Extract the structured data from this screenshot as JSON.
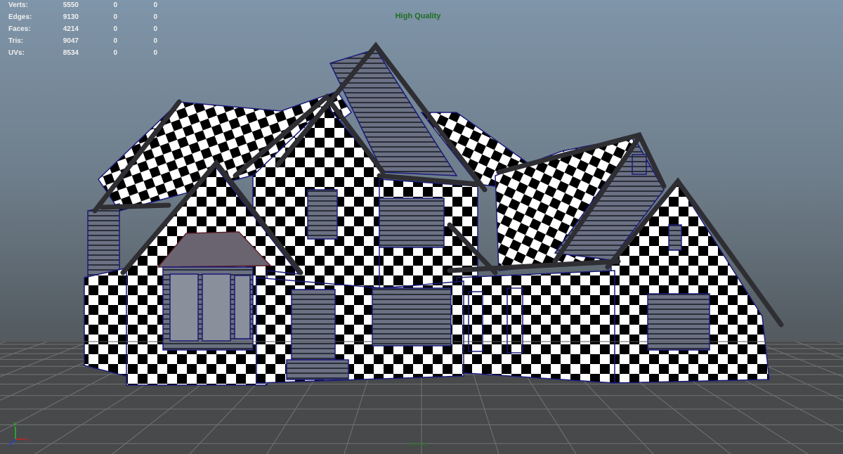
{
  "hud": {
    "rows": [
      {
        "label": "Verts:",
        "values": [
          "5550",
          "0",
          "0"
        ]
      },
      {
        "label": "Edges:",
        "values": [
          "9130",
          "0",
          "0"
        ]
      },
      {
        "label": "Faces:",
        "values": [
          "4214",
          "0",
          "0"
        ]
      },
      {
        "label": "Tris:",
        "values": [
          "9047",
          "0",
          "0"
        ]
      },
      {
        "label": "UVs:",
        "values": [
          "8534",
          "0",
          "0"
        ]
      }
    ]
  },
  "viewport": {
    "render_mode": "High Quality",
    "camera": "persp",
    "model": "house-checker-uv"
  },
  "colors": {
    "hud_text": "#f0f0f0",
    "quality_text": "#1f6e1f",
    "wireframe": "#1a1a7a",
    "trim": "#2e2e33",
    "ground_grid": "#7a7a7a"
  },
  "axis_gizmo": {
    "x": "x",
    "y": "y",
    "z": "z"
  }
}
